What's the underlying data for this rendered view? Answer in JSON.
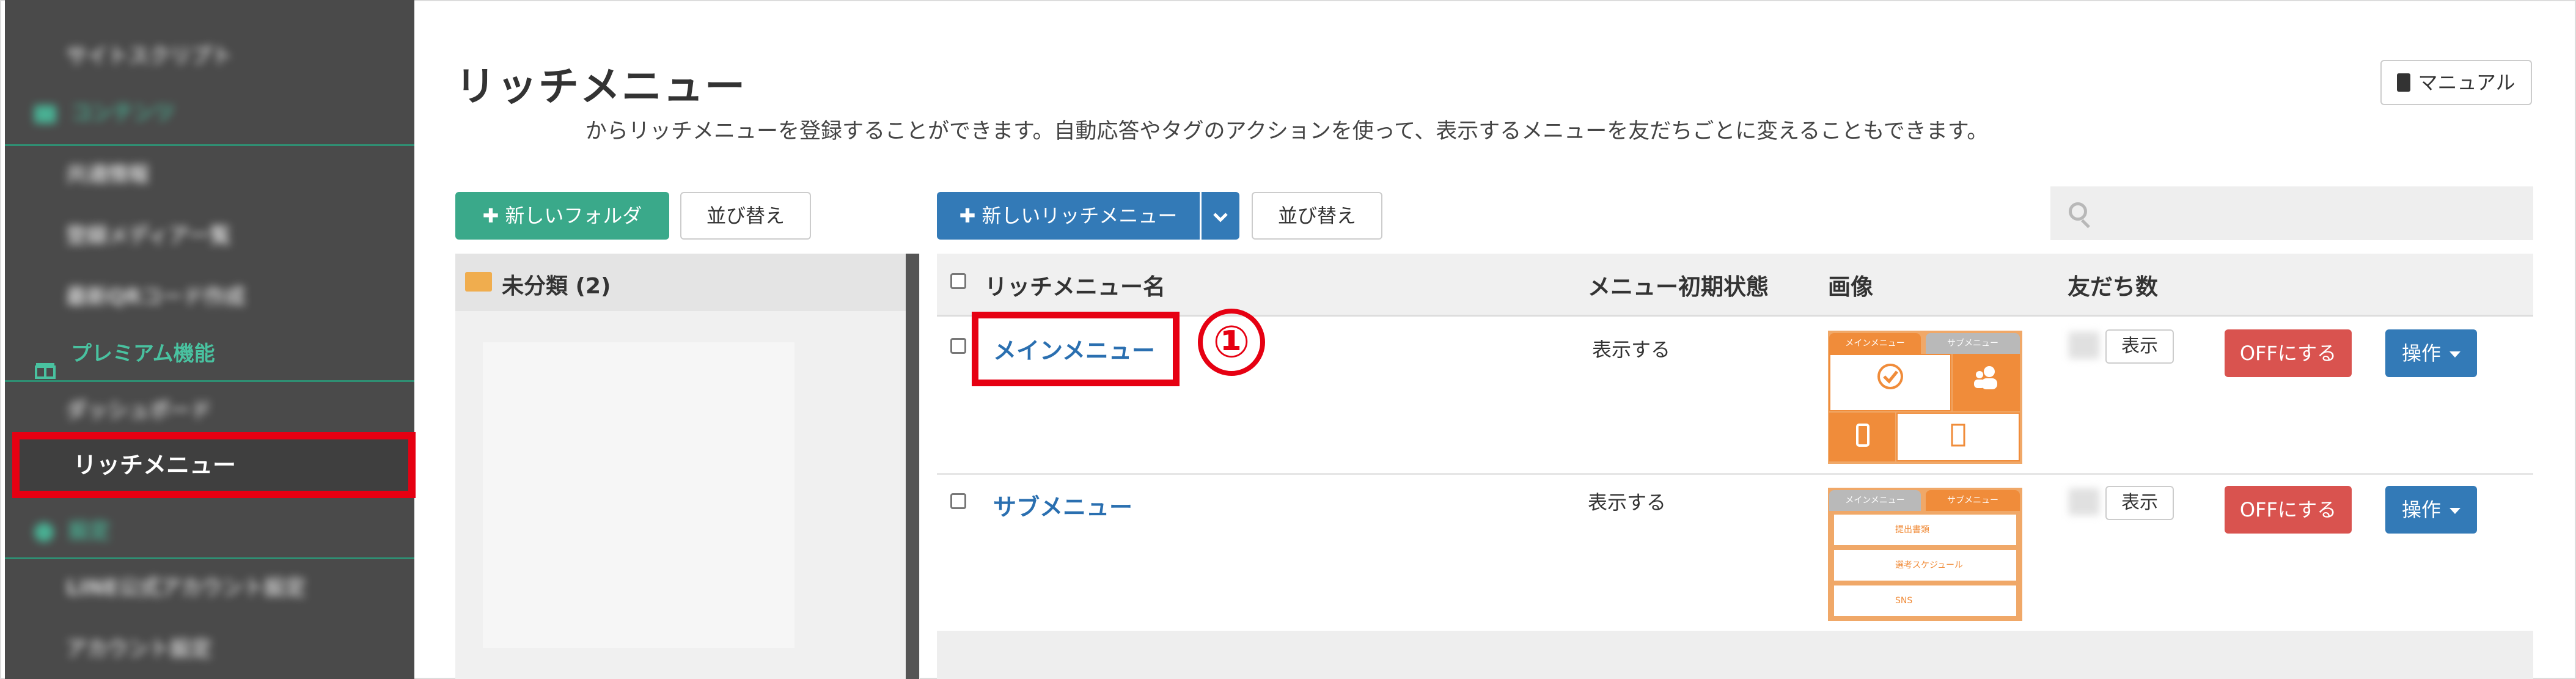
{
  "sidebar": {
    "items": [
      {
        "label": "サイトスクリプト",
        "kind": "sub",
        "blurred": true
      },
      {
        "label": "コンテンツ",
        "kind": "head",
        "blurred": true,
        "icon": "folder-icon"
      },
      {
        "label": "共通情報",
        "kind": "sub",
        "blurred": true
      },
      {
        "label": "登録メディア一覧",
        "kind": "sub",
        "blurred": true
      },
      {
        "label": "最新QRコード作成",
        "kind": "sub",
        "blurred": true
      },
      {
        "label": "プレミアム機能",
        "kind": "head",
        "blurred": false,
        "icon": "gift-icon"
      },
      {
        "label": "ダッシュボード",
        "kind": "sub",
        "blurred": true
      },
      {
        "label": "リッチメニュー",
        "kind": "active",
        "blurred": false
      },
      {
        "label": "設定",
        "kind": "head",
        "blurred": true,
        "icon": "gear-icon"
      },
      {
        "label": "LINE公式アカウント設定",
        "kind": "sub",
        "blurred": true
      },
      {
        "label": "アカウント設定",
        "kind": "sub",
        "blurred": true
      }
    ]
  },
  "header": {
    "title": "リッチメニュー",
    "description": "からリッチメニューを登録することができます。自動応答やタグのアクションを使って、表示するメニューを友だちごとに変えることもできます。",
    "manual_label": "マニュアル"
  },
  "toolbar": {
    "new_folder": "新しいフォルダ",
    "sort_folders": "並び替え",
    "new_richmenu": "新しいリッチメニュー",
    "sort_menus": "並び替え"
  },
  "search": {
    "placeholder": ""
  },
  "folders": [
    {
      "label": "未分類 (2)"
    }
  ],
  "table": {
    "headers": {
      "name": "リッチメニュー名",
      "initial_state": "メニュー初期状態",
      "image": "画像",
      "friends": "友だち数"
    },
    "rows": [
      {
        "name": "メインメニュー",
        "initial_state": "表示する",
        "show_label": "表示",
        "off_label": "OFFにする",
        "ops_label": "操作"
      },
      {
        "name": "サブメニュー",
        "initial_state": "表示する",
        "show_label": "表示",
        "off_label": "OFFにする",
        "ops_label": "操作"
      }
    ]
  },
  "thumbnails": {
    "main": {
      "tab_main": "メインメニュー",
      "tab_sub": "サブメニュー"
    },
    "sub": {
      "tab_main": "メインメニュー",
      "tab_sub": "サブメニュー",
      "items": [
        "提出書類",
        "選考スケジュール",
        "SNS"
      ]
    }
  },
  "annotation": {
    "marker": "①"
  },
  "colors": {
    "accent_green": "#3aa98a",
    "primary_blue": "#337ab7",
    "danger_red": "#d9534f",
    "highlight_red": "#e60012",
    "link_blue": "#2a6fb0"
  }
}
